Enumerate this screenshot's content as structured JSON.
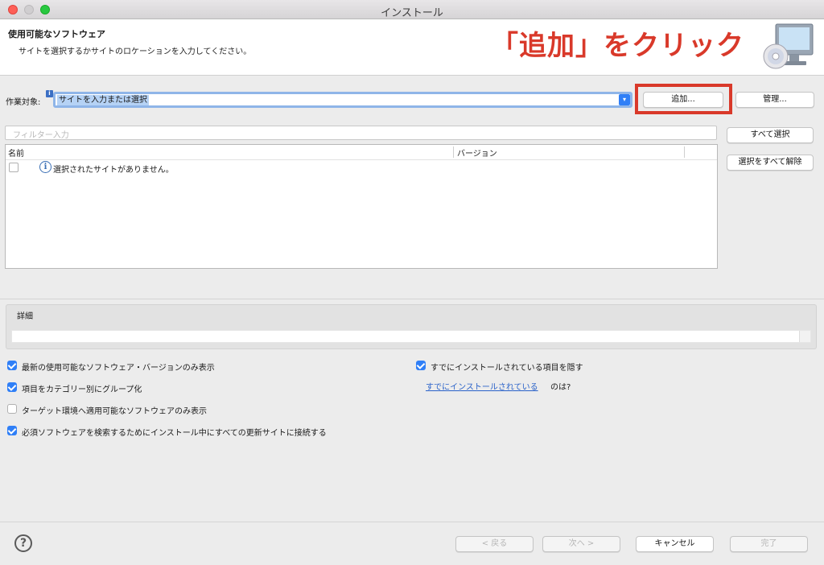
{
  "window": {
    "title": "インストール"
  },
  "header": {
    "title": "使用可能なソフトウェア",
    "description": "サイトを選択するかサイトのロケーションを入力してください。",
    "annotation": "「追加」をクリック"
  },
  "work_with": {
    "label": "作業対象:",
    "info_badge": "i",
    "value": "サイトを入力または選択",
    "add_button": "追加...",
    "manage_button": "管理..."
  },
  "filter": {
    "placeholder": "フィルター入力"
  },
  "side_buttons": {
    "select_all": "すべて選択",
    "deselect_all": "選択をすべて解除"
  },
  "table": {
    "columns": [
      "名前",
      "バージョン"
    ],
    "rows": [
      {
        "name": "選択されたサイトがありません。",
        "checked": false
      }
    ]
  },
  "details": {
    "label": "詳細"
  },
  "options": {
    "latest_only": {
      "label": "最新の使用可能なソフトウェア・バージョンのみ表示",
      "checked": true
    },
    "group_by_category": {
      "label": "項目をカテゴリー別にグループ化",
      "checked": true
    },
    "target_env_only": {
      "label": "ターゲット環境へ適用可能なソフトウェアのみ表示",
      "checked": false
    },
    "contact_all_sites": {
      "label": "必須ソフトウェアを検索するためにインストール中にすべての更新サイトに接続する",
      "checked": true
    },
    "hide_installed": {
      "label": "すでにインストールされている項目を隠す",
      "checked": true
    },
    "installed_link": "すでにインストールされている",
    "installed_link_tail": "のは?"
  },
  "footer": {
    "help": "?",
    "back": "< 戻る",
    "next": "次へ >",
    "cancel": "キャンセル",
    "finish": "完了"
  },
  "colors": {
    "accent": "#2f7ff7",
    "annotation": "#d9392a",
    "link": "#2a62c9"
  }
}
